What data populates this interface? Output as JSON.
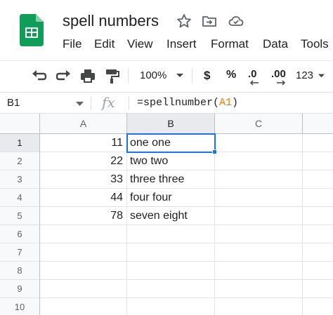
{
  "doc": {
    "title": "spell numbers"
  },
  "title_icons": [
    "star-icon",
    "move-to-folder-icon",
    "cloud-saved-icon"
  ],
  "menu": [
    "File",
    "Edit",
    "View",
    "Insert",
    "Format",
    "Data",
    "Tools"
  ],
  "toolbar": {
    "zoom": "100%",
    "currency": "$",
    "percent": "%",
    "decrease_decimal": ".0",
    "increase_decimal": ".00",
    "more_formats": "123"
  },
  "formula_bar": {
    "cell_ref": "B1",
    "fx": "fx",
    "formula_prefix": "=spellnumber(",
    "formula_ref": "A1",
    "formula_suffix": ")"
  },
  "sheet": {
    "columns": [
      "A",
      "B",
      "C"
    ],
    "rows": [
      "1",
      "2",
      "3",
      "4",
      "5",
      "6",
      "7",
      "8",
      "9",
      "10"
    ],
    "a": [
      "11",
      "22",
      "33",
      "44",
      "78",
      "",
      "",
      "",
      "",
      ""
    ],
    "b": [
      "one one",
      "two two",
      "three three",
      "four four",
      "seven eight",
      "",
      "",
      "",
      "",
      ""
    ],
    "c": [
      "",
      "",
      "",
      "",
      "",
      "",
      "",
      "",
      "",
      ""
    ],
    "selected_cell": "B1"
  },
  "colors": {
    "accent": "#1a73e8",
    "sheets_green": "#0f9d58",
    "ref_orange": "#f57c00"
  }
}
